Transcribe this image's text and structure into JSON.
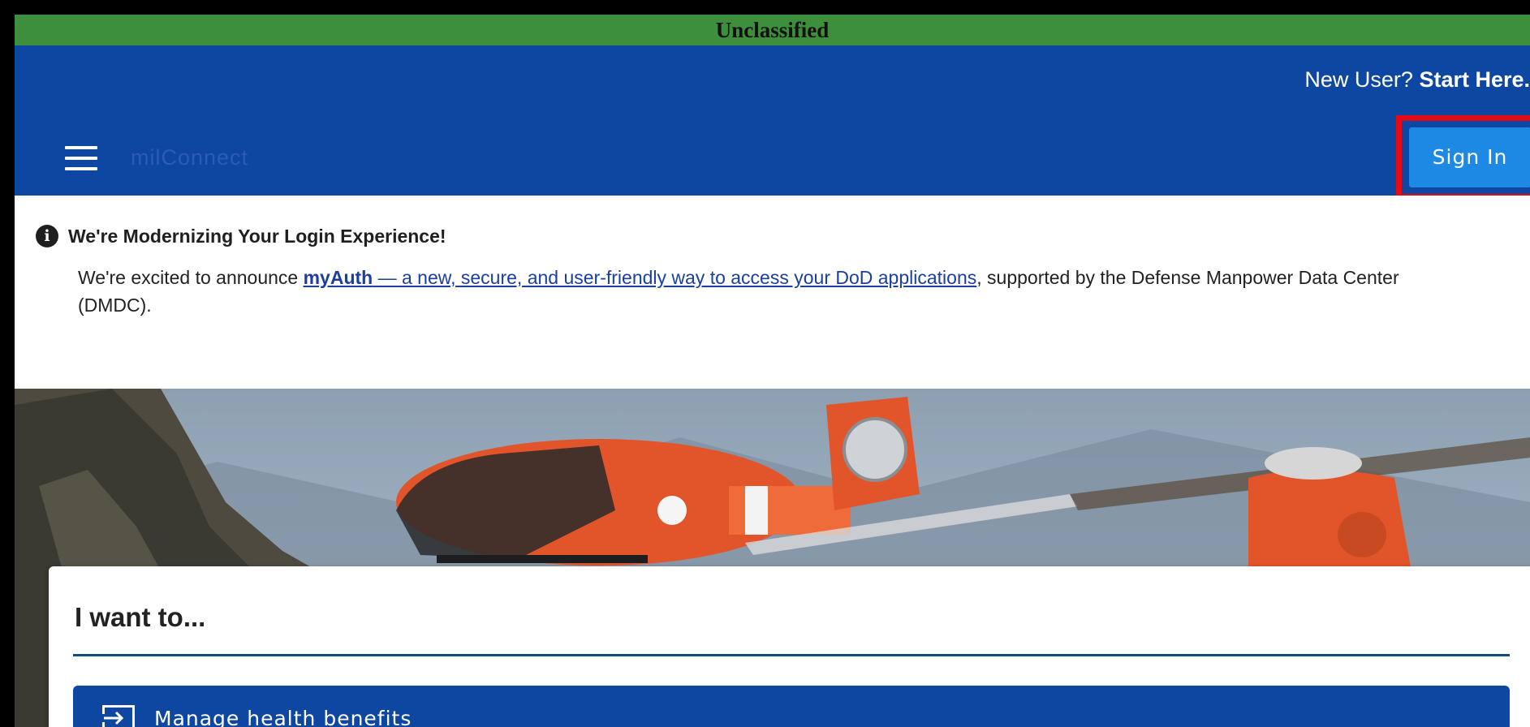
{
  "classification_banner": "Unclassified",
  "header": {
    "new_user_prefix": "New User?",
    "new_user_link": "Start Here.",
    "app_name": "milConnect",
    "sign_in_label": "Sign In",
    "menu_icon": "hamburger-menu-icon"
  },
  "notice": {
    "icon": "info-icon",
    "title": "We're Modernizing Your Login Experience!",
    "body_prefix": "We're excited to announce ",
    "link_strong": "myAuth",
    "link_rest": " — a new, secure, and user-friendly way to access your DoD applications",
    "body_suffix": ", supported by the Defense Manpower Data Center (DMDC)."
  },
  "card": {
    "title": "I want to...",
    "actions": [
      {
        "label": "Manage health benefits",
        "icon": "login-arrow-icon"
      }
    ]
  },
  "colors": {
    "banner_green": "#3d8f3c",
    "header_blue": "#0d47a1",
    "signin_blue": "#1e88e5",
    "highlight_red": "#e30b17"
  }
}
